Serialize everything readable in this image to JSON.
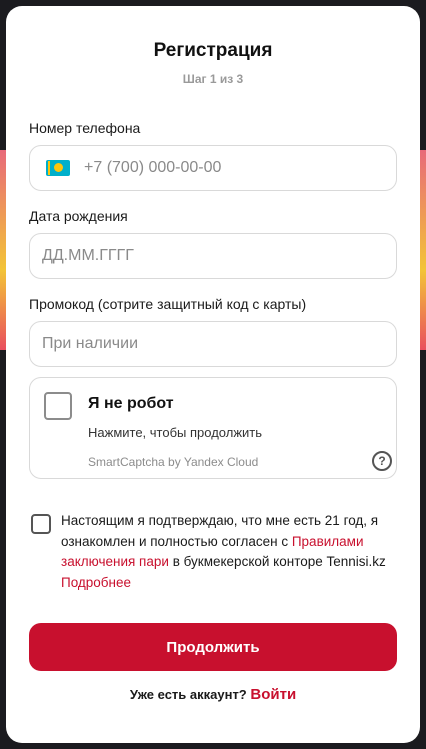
{
  "modal": {
    "title": "Регистрация",
    "step": "Шаг 1 из 3"
  },
  "phone": {
    "label": "Номер телефона",
    "placeholder": "+7 (700) 000-00-00",
    "flag_icon": "kazakhstan-flag-icon",
    "flag_colors": {
      "field": "#00afca",
      "emblem": "#fec50c"
    }
  },
  "birthdate": {
    "label": "Дата рождения",
    "placeholder": "ДД.ММ.ГГГГ"
  },
  "promo": {
    "label": "Промокод (сотрите защитный код с карты)",
    "placeholder": "При наличии"
  },
  "captcha": {
    "title": "Я не робот",
    "subtitle": "Нажмите, чтобы продолжить",
    "brand": "SmartCaptcha by Yandex Cloud",
    "help_glyph": "?"
  },
  "consent": {
    "text_before": "Настоящим я подтверждаю, что мне есть 21 год, я ознакомлен и полностью согласен с ",
    "rules_link": "Правилами заключения пари",
    "text_middle": " в букмекерской конторе Tennisi.kz ",
    "more_link": "Подробнее"
  },
  "submit_label": "Продолжить",
  "login": {
    "prompt": "Уже есть аккаунт? ",
    "link": "Войти"
  },
  "colors": {
    "accent": "#c8102e",
    "muted": "#9a9a9a",
    "border": "#d9d9d9"
  }
}
